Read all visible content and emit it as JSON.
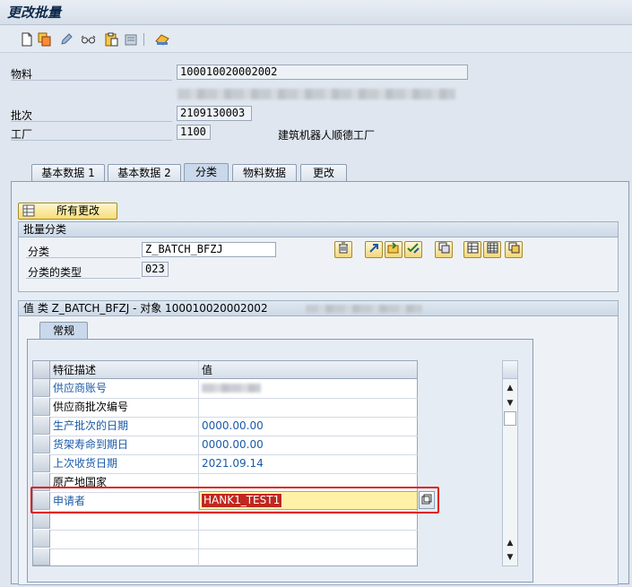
{
  "title": "更改批量",
  "toolbar": {
    "icons": [
      "new-document-icon",
      "copy-icon",
      "edit-pencil-icon",
      "glasses-display-icon",
      "clipboard-icon",
      "other-object-icon",
      "transport-icon"
    ]
  },
  "header": {
    "material_label": "物料",
    "material_value": "100010020002002",
    "batch_label": "批次",
    "batch_value": "2109130003",
    "plant_label": "工厂",
    "plant_value": "1100",
    "plant_name": "建筑机器人顺德工厂"
  },
  "tabs": [
    {
      "label": "基本数据 1"
    },
    {
      "label": "基本数据 2"
    },
    {
      "label": "分类"
    },
    {
      "label": "物料数据"
    },
    {
      "label": "更改"
    }
  ],
  "all_changes_button": "所有更改",
  "batch_class": {
    "header": "批量分类",
    "class_label": "分类",
    "class_value": "Z_BATCH_BFZJ",
    "class_type_label": "分类的类型",
    "class_type_value": "023"
  },
  "values_group": {
    "header": "值 类 Z_BATCH_BFZJ - 对象 100010020002002",
    "subtab": "常规",
    "col_char": "特征描述",
    "col_value": "值",
    "rows": [
      {
        "desc": "供应商账号",
        "value": ""
      },
      {
        "desc": "供应商批次编号",
        "value": ""
      },
      {
        "desc": "生产批次的日期",
        "value": "0000.00.00"
      },
      {
        "desc": "货架寿命到期日",
        "value": "0000.00.00"
      },
      {
        "desc": "上次收货日期",
        "value": "2021.09.14"
      },
      {
        "desc": "原产地国家",
        "value": ""
      },
      {
        "desc": "申请者",
        "value": "HANK1_TEST1"
      }
    ]
  },
  "colors": {
    "accent_blue": "#1a5aa8",
    "highlight_red": "#e0201b",
    "edit_yellow": "#fff2a8"
  }
}
